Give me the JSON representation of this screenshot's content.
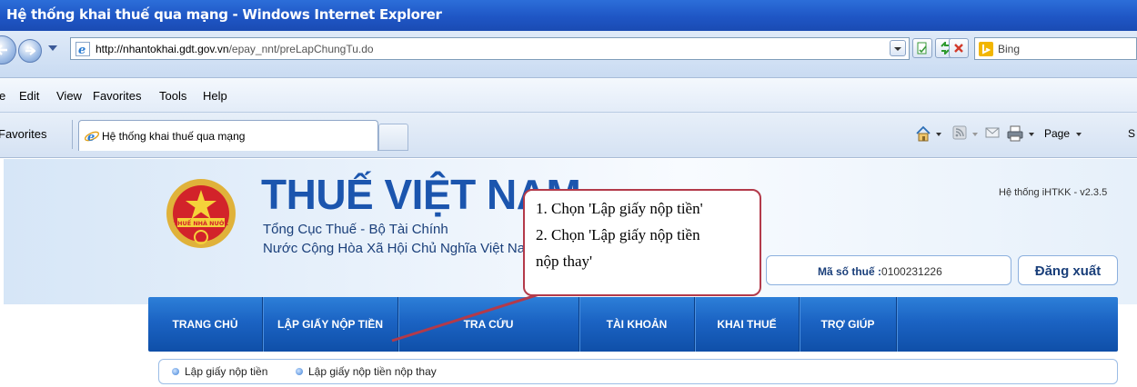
{
  "window": {
    "title": "Hệ thống khai thuế qua mạng - Windows Internet Explorer"
  },
  "address_bar": {
    "url_host": "http://nhantokhai.gdt.gov.vn",
    "url_path": "/epay_nnt/preLapChungTu.do",
    "search_placeholder": "Bing"
  },
  "menu": [
    "e",
    "Edit",
    "View",
    "Favorites",
    "Tools",
    "Help"
  ],
  "tab_bar": {
    "favorites_label": "Favorites",
    "active_tab_title": "Hệ thống khai thuế qua mạng",
    "page_menu_label": "Page",
    "safety_menu_partial": "S"
  },
  "site": {
    "emblem_text": "THUẾ NHÀ NƯỚC",
    "title": "THUẾ VIỆT NAM",
    "subtitle_1": "Tổng Cục Thuế - Bộ Tài Chính",
    "subtitle_2": "Nước Cộng Hòa Xã Hội Chủ Nghĩa Việt Nam",
    "version": "Hệ thống iHTKK - v2.3.5",
    "tax_code_label": "Mã số thuế :",
    "tax_code_value": "0100231226",
    "logout_label": "Đăng xuất"
  },
  "nav": [
    "TRANG CHỦ",
    "LẬP GIẤY NỘP TIỀN",
    "TRA CỨU",
    "TÀI KHOẢN",
    "KHAI THUẾ",
    "TRỢ GIÚP"
  ],
  "submenu": [
    "Lập giấy nộp tiền",
    "Lập giấy nộp tiền nộp thay"
  ],
  "callout": {
    "line_1": "1. Chọn 'Lập giấy nộp tiền'",
    "line_2": "2. Chọn 'Lập giấy nộp tiền",
    "line_3": "nộp thay'"
  },
  "colors": {
    "titlebar": "#1f56c5",
    "nav_bar": "#1b63c3",
    "brand_blue": "#1b55ae",
    "callout_border": "#b33a4a"
  }
}
